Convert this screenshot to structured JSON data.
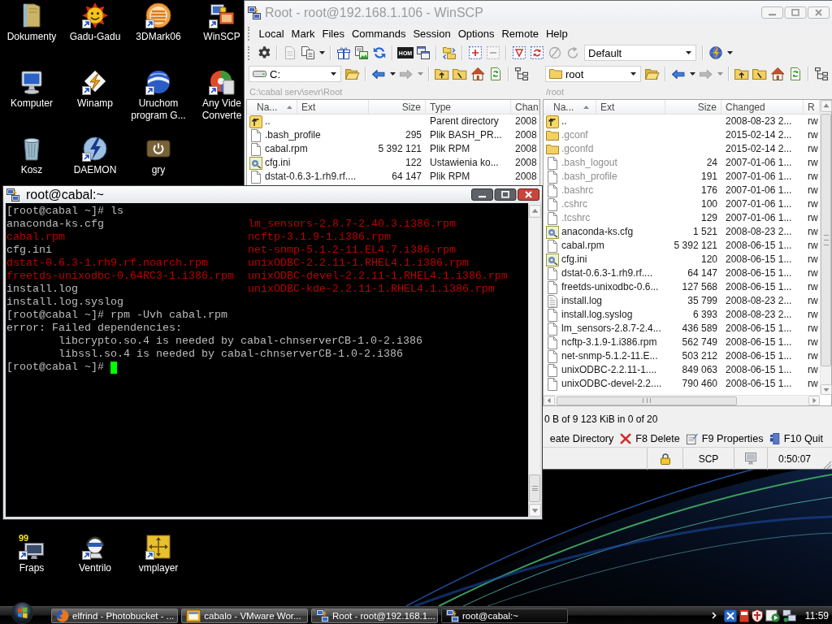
{
  "desktop": {
    "shortcuts": [
      {
        "label": "Dokumenty",
        "kind": "documents",
        "shortcut": false
      },
      {
        "label": "Gadu-Gadu",
        "kind": "sun",
        "shortcut": true
      },
      {
        "label": "3DMark06",
        "kind": "stripes",
        "shortcut": true
      },
      {
        "label": "WinSCP",
        "kind": "computers",
        "shortcut": true
      },
      {
        "label": "Komputer",
        "kind": "monitor",
        "shortcut": false
      },
      {
        "label": "Winamp",
        "kind": "bolt",
        "shortcut": true
      },
      {
        "label": "Uruchom program G...",
        "kind": "globe",
        "shortcut": true
      },
      {
        "label": "Any Vide\nConverte",
        "kind": "disc",
        "shortcut": true
      },
      {
        "label": "Kosz",
        "kind": "bin",
        "shortcut": false
      },
      {
        "label": "DAEMON",
        "kind": "boltdisc",
        "shortcut": true
      },
      {
        "label": "gry",
        "kind": "power",
        "shortcut": false
      }
    ],
    "lower_shortcuts": [
      {
        "label": "Fraps",
        "kind": "fraps",
        "badge": "99",
        "shortcut": true
      },
      {
        "label": "Ventrilo",
        "kind": "headset",
        "shortcut": true
      },
      {
        "label": "vmplayer",
        "kind": "tiles",
        "shortcut": true
      }
    ]
  },
  "winscp": {
    "title": "Root - root@192.168.1.106 - WinSCP",
    "active": false,
    "menu": [
      "Local",
      "Mark",
      "Files",
      "Commands",
      "Session",
      "Options",
      "Remote",
      "Help"
    ],
    "toolbar": [
      {
        "kind": "gear",
        "disabled": false
      },
      {
        "kind": "separator"
      },
      {
        "kind": "page",
        "disabled": true
      },
      {
        "kind": "pages",
        "disabled": false
      },
      {
        "kind": "caret",
        "disabled": false
      },
      {
        "kind": "separator"
      },
      {
        "kind": "gift",
        "disabled": false
      },
      {
        "kind": "picture",
        "disabled": false
      },
      {
        "kind": "reload",
        "disabled": false
      },
      {
        "kind": "separator"
      },
      {
        "kind": "console",
        "text": "HOM",
        "disabled": false
      },
      {
        "kind": "windows",
        "disabled": false
      },
      {
        "kind": "separator"
      },
      {
        "kind": "folders",
        "disabled": false
      },
      {
        "kind": "separator"
      },
      {
        "kind": "plus",
        "disabled": false
      },
      {
        "kind": "minus",
        "disabled": true
      },
      {
        "kind": "separator"
      },
      {
        "kind": "filter",
        "disabled": false
      },
      {
        "kind": "sync",
        "disabled": false
      },
      {
        "kind": "slash",
        "disabled": true
      },
      {
        "kind": "rotate",
        "disabled": true
      },
      {
        "kind": "combo",
        "value": "Default"
      },
      {
        "kind": "separator"
      },
      {
        "kind": "globe",
        "disabled": false
      },
      {
        "kind": "caret",
        "disabled": false
      }
    ],
    "panels": [
      {
        "nav": [
          {
            "kind": "combo",
            "value": "C:"
          },
          {
            "kind": "open",
            "disabled": false
          },
          {
            "kind": "separator"
          },
          {
            "kind": "back",
            "disabled": false
          },
          {
            "kind": "caret",
            "disabled": false
          },
          {
            "kind": "forward",
            "disabled": true
          },
          {
            "kind": "caret",
            "disabled": true
          },
          {
            "kind": "separator"
          },
          {
            "kind": "up",
            "disabled": false
          },
          {
            "kind": "root",
            "disabled": false
          },
          {
            "kind": "home",
            "disabled": false
          },
          {
            "kind": "refresh",
            "disabled": false
          },
          {
            "kind": "separator"
          },
          {
            "kind": "tree",
            "disabled": false
          }
        ],
        "path": "C:\\cabal serv\\sevr\\Root",
        "columns": [
          "Na...",
          "Ext",
          "Size",
          "Type",
          "Chan"
        ],
        "rows": [
          {
            "kind": "parent",
            "cells": [
              "..",
              "",
              "",
              "Parent directory",
              "2008"
            ]
          },
          {
            "kind": "file",
            "cells": [
              ".bash_profile",
              "",
              "295",
              "Plik BASH_PR...",
              "2008"
            ]
          },
          {
            "kind": "file",
            "cells": [
              "cabal.rpm",
              "",
              "5 392 121",
              "Plik RPM",
              "2008"
            ]
          },
          {
            "kind": "settings",
            "cells": [
              "cfg.ini",
              "",
              "122",
              "Ustawienia ko...",
              "2008"
            ]
          },
          {
            "kind": "file",
            "cells": [
              "dstat-0.6.3-1.rh9.rf....",
              "",
              "64 147",
              "Plik RPM",
              "2008"
            ]
          }
        ]
      },
      {
        "nav": [
          {
            "kind": "combo",
            "value": "root"
          },
          {
            "kind": "open",
            "disabled": false
          },
          {
            "kind": "separator"
          },
          {
            "kind": "back",
            "disabled": false
          },
          {
            "kind": "caret",
            "disabled": false
          },
          {
            "kind": "forward",
            "disabled": true
          },
          {
            "kind": "caret",
            "disabled": true
          },
          {
            "kind": "separator"
          },
          {
            "kind": "up",
            "disabled": false
          },
          {
            "kind": "root",
            "disabled": false
          },
          {
            "kind": "home",
            "disabled": false
          },
          {
            "kind": "refresh",
            "disabled": false
          },
          {
            "kind": "separator"
          },
          {
            "kind": "tree",
            "disabled": false
          }
        ],
        "path": "/root",
        "columns": [
          "Na...",
          "Ext",
          "Size",
          "Changed",
          "R"
        ],
        "rows": [
          {
            "kind": "parent",
            "hidden": false,
            "cells": [
              "..",
              "",
              "",
              "2008-08-23 2...",
              "rw"
            ]
          },
          {
            "kind": "folder",
            "hidden": true,
            "cells": [
              ".gconf",
              "",
              "",
              "2015-02-14 2...",
              "rw"
            ]
          },
          {
            "kind": "folder",
            "hidden": true,
            "cells": [
              ".gconfd",
              "",
              "",
              "2015-02-14 2...",
              "rw"
            ]
          },
          {
            "kind": "file",
            "hidden": true,
            "cells": [
              ".bash_logout",
              "",
              "24",
              "2007-01-06 1...",
              "rw"
            ]
          },
          {
            "kind": "file",
            "hidden": true,
            "cells": [
              ".bash_profile",
              "",
              "191",
              "2007-01-06 1...",
              "rw"
            ]
          },
          {
            "kind": "file",
            "hidden": true,
            "cells": [
              ".bashrc",
              "",
              "176",
              "2007-01-06 1...",
              "rw"
            ]
          },
          {
            "kind": "file",
            "hidden": true,
            "cells": [
              ".cshrc",
              "",
              "100",
              "2007-01-06 1...",
              "rw"
            ]
          },
          {
            "kind": "file",
            "hidden": true,
            "cells": [
              ".tcshrc",
              "",
              "129",
              "2007-01-06 1...",
              "rw"
            ]
          },
          {
            "kind": "settings",
            "hidden": false,
            "cells": [
              "anaconda-ks.cfg",
              "",
              "1 521",
              "2008-08-23 2...",
              "rw"
            ]
          },
          {
            "kind": "file",
            "hidden": false,
            "cells": [
              "cabal.rpm",
              "",
              "5 392 121",
              "2008-06-15 1...",
              "rw"
            ]
          },
          {
            "kind": "settings",
            "hidden": false,
            "cells": [
              "cfg.ini",
              "",
              "120",
              "2008-06-15 1...",
              "rw"
            ]
          },
          {
            "kind": "file",
            "hidden": false,
            "cells": [
              "dstat-0.6.3-1.rh9.rf....",
              "",
              "64 147",
              "2008-06-15 1...",
              "rw"
            ]
          },
          {
            "kind": "file",
            "hidden": false,
            "cells": [
              "freetds-unixodbc-0.6...",
              "",
              "127 568",
              "2008-06-15 1...",
              "rw"
            ]
          },
          {
            "kind": "text",
            "hidden": false,
            "cells": [
              "install.log",
              "",
              "35 799",
              "2008-08-23 2...",
              "rw"
            ]
          },
          {
            "kind": "file",
            "hidden": false,
            "cells": [
              "install.log.syslog",
              "",
              "6 393",
              "2008-08-23 2...",
              "rw"
            ]
          },
          {
            "kind": "file",
            "hidden": false,
            "cells": [
              "lm_sensors-2.8.7-2.4...",
              "",
              "436 589",
              "2008-06-15 1...",
              "rw"
            ]
          },
          {
            "kind": "file",
            "hidden": false,
            "cells": [
              "ncftp-3.1.9-1.i386.rpm",
              "",
              "562 749",
              "2008-06-15 1...",
              "rw"
            ]
          },
          {
            "kind": "file",
            "hidden": false,
            "cells": [
              "net-snmp-5.1.2-11.E...",
              "",
              "503 212",
              "2008-06-15 1...",
              "rw"
            ]
          },
          {
            "kind": "file",
            "hidden": false,
            "cells": [
              "unixODBC-2.2.11-1....",
              "",
              "849 063",
              "2008-06-15 1...",
              "rw"
            ]
          },
          {
            "kind": "file",
            "hidden": false,
            "cells": [
              "unixODBC-devel-2.2....",
              "",
              "790 460",
              "2008-06-15 1...",
              "rw"
            ]
          }
        ],
        "status": "0 B of 9 123 KiB in 0 of 20"
      }
    ],
    "function_keys": [
      {
        "label": "eate Directory",
        "kind": "covered"
      },
      {
        "label": "F8 Delete",
        "kind": "delete"
      },
      {
        "label": "F9 Properties",
        "kind": "properties"
      },
      {
        "label": "F10 Quit",
        "kind": "quit"
      }
    ],
    "status_bar": {
      "protocol": "SCP",
      "elapsed": "0:50:07"
    }
  },
  "terminal": {
    "title": "root@cabal:~",
    "active": true,
    "lines": [
      {
        "kind": "command",
        "text": "[root@cabal ~]# ls",
        "cursor": false
      },
      {
        "kind": "listing",
        "files": [
          {
            "name": "anaconda-ks.cfg",
            "color": "#bbbbbb"
          },
          {
            "name": "cabal.rpm",
            "color": "#bb0000"
          },
          {
            "name": "cfg.ini",
            "color": "#bbbbbb"
          },
          {
            "name": "dstat-0.6.3-1.rh9.rf.noarch.rpm",
            "color": "#bb0000"
          },
          {
            "name": "freetds-unixodbc-0.64RC3-1.i386.rpm",
            "color": "#bb0000"
          },
          {
            "name": "install.log",
            "color": "#bbbbbb"
          },
          {
            "name": "install.log.syslog",
            "color": "#bbbbbb"
          },
          {
            "name": "lm_sensors-2.8.7-2.40.3.i386.rpm",
            "color": "#bb0000"
          },
          {
            "name": "ncftp-3.1.9-1.i386.rpm",
            "color": "#bb0000"
          },
          {
            "name": "net-snmp-5.1.2-11.EL4.7.i386.rpm",
            "color": "#bb0000"
          },
          {
            "name": "unixODBC-2.2.11-1.RHEL4.1.i386.rpm",
            "color": "#bb0000"
          },
          {
            "name": "unixODBC-devel-2.2.11-1.RHEL4.1.i386.rpm",
            "color": "#bb0000"
          },
          {
            "name": "unixODBC-kde-2.2.11-1.RHEL4.1.i386.rpm",
            "color": "#bb0000"
          }
        ]
      },
      {
        "kind": "command",
        "text": "[root@cabal ~]# rpm -Uvh cabal.rpm",
        "cursor": false
      },
      {
        "kind": "output",
        "text": "error: Failed dependencies:"
      },
      {
        "kind": "detail",
        "text": "libcrypto.so.4 is needed by cabal-chnserverCB-1.0-2.i386"
      },
      {
        "kind": "detail",
        "text": "libssl.so.4 is needed by cabal-chnserverCB-1.0-2.i386"
      },
      {
        "kind": "command",
        "text": "[root@cabal ~]#",
        "cursor": true
      }
    ]
  },
  "taskbar": {
    "tasks": [
      {
        "label": "elfrind - Photobucket - ...",
        "kind": "browser",
        "selected": false
      },
      {
        "label": "cabalo - VMware Wor...",
        "kind": "vm",
        "selected": false
      },
      {
        "label": "Root - root@192.168.1...",
        "kind": "transfer",
        "selected": false
      },
      {
        "label": "root@cabal:~",
        "kind": "terminal",
        "selected": true
      }
    ],
    "clock": "11:59"
  }
}
